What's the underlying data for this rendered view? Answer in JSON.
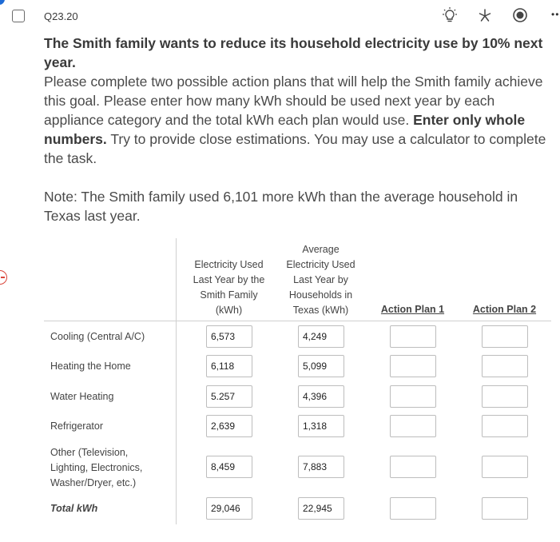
{
  "question": {
    "id": "Q23.20",
    "lead": "The Smith family wants to reduce its household electricity use by 10% next year.",
    "body_pre": "Please complete two possible action plans that will help the Smith family achieve this goal. Please enter how many kWh should be used next year by each appliance category and the total kWh each plan would use. ",
    "body_bold": "Enter only whole numbers.",
    "body_post": " Try to provide close estimations. You may use a calculator to complete the task.",
    "note": "Note: The Smith family used 6,101 more kWh than the average household in Texas last year."
  },
  "toolbar": {
    "icons": [
      "lightbulb-icon",
      "star-icon",
      "radio-icon",
      "more-icon"
    ]
  },
  "matrix": {
    "headers": {
      "smith": [
        "Electricity Used",
        "Last Year by the",
        "Smith Family",
        "(kWh)"
      ],
      "average": [
        "Average",
        "Electricity Used",
        "Last Year by",
        "Households in",
        "Texas (kWh)"
      ],
      "plan1": "Action Plan 1",
      "plan2": "Action Plan 2"
    },
    "rows": [
      {
        "label": [
          "Cooling (Central A/C)"
        ],
        "smith": "6,573",
        "average": "4,249"
      },
      {
        "label": [
          "Heating the Home"
        ],
        "smith": "6,118",
        "average": "5,099"
      },
      {
        "label": [
          "Water Heating"
        ],
        "smith": "5.257",
        "average": "4,396"
      },
      {
        "label": [
          "Refrigerator"
        ],
        "smith": "2,639",
        "average": "1,318"
      },
      {
        "label": [
          "Other (Television,",
          "Lighting, Electronics,",
          "Washer/Dryer, etc.)"
        ],
        "smith": "8,459",
        "average": "7,883"
      },
      {
        "label": [
          "Total kWh"
        ],
        "smith": "29,046",
        "average": "22,945"
      }
    ]
  },
  "colors": {
    "accent": "#1e6bd6",
    "remove": "#d9453a"
  }
}
